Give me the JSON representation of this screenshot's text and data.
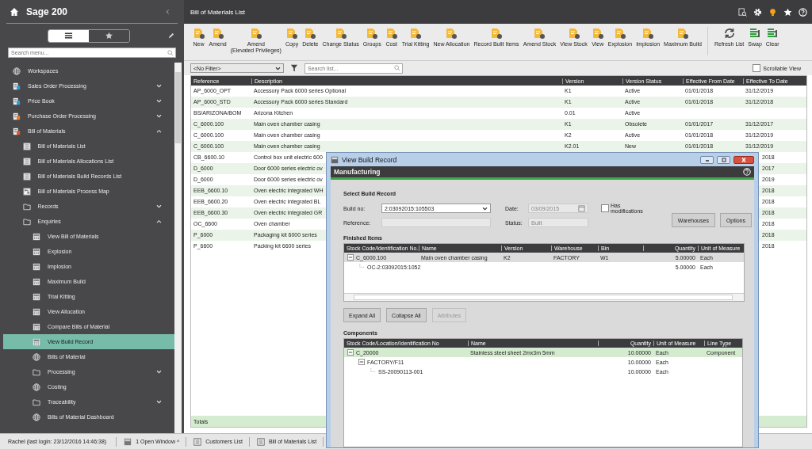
{
  "sidebar": {
    "title": "Sage 200",
    "view_tabs": [
      {
        "kind": "menu",
        "selected": true
      },
      {
        "kind": "favourites",
        "selected": false
      }
    ],
    "search": {
      "placeholder": "Search menu..."
    },
    "items": [
      {
        "label": "Workspaces",
        "kind": "workspace",
        "selected": false
      },
      {
        "label": "Sales Order Processing",
        "kind": "module",
        "selected": false,
        "expanded": false
      },
      {
        "label": "Price Book",
        "kind": "module",
        "selected": false,
        "expanded": false
      },
      {
        "label": "Purchase Order Processing",
        "kind": "module",
        "selected": false,
        "expanded": false
      },
      {
        "label": "Bill of Materials",
        "kind": "module",
        "selected": false,
        "expanded": true,
        "children": [
          {
            "label": "Bill of Materials List",
            "kind": "page",
            "selected": false
          },
          {
            "label": "Bill of Materials Allocations List",
            "kind": "page",
            "selected": false
          },
          {
            "label": "Bill of Materials Build Records List",
            "kind": "page",
            "selected": false
          },
          {
            "label": "Bill of Materials Process Map",
            "kind": "map",
            "selected": false
          },
          {
            "label": "Records",
            "kind": "folder",
            "selected": false,
            "expanded": false
          },
          {
            "label": "Enquiries",
            "kind": "folder",
            "selected": false,
            "expanded": true,
            "children": [
              {
                "label": "View Bill of Materials",
                "kind": "enquiry",
                "selected": false
              },
              {
                "label": "Explosion",
                "kind": "enquiry",
                "selected": false
              },
              {
                "label": "Implosion",
                "kind": "enquiry",
                "selected": false
              },
              {
                "label": "Maximum Build",
                "kind": "enquiry",
                "selected": false
              },
              {
                "label": "Trial Kitting",
                "kind": "enquiry",
                "selected": false
              },
              {
                "label": "View Allocation",
                "kind": "enquiry",
                "selected": false
              },
              {
                "label": "Compare Bills of Material",
                "kind": "enquiry",
                "selected": false
              },
              {
                "label": "View Build Record",
                "kind": "enquiry",
                "selected": true
              },
              {
                "label": "Bills of Material",
                "kind": "workspace",
                "selected": false
              },
              {
                "label": "Processing",
                "kind": "folder",
                "selected": false,
                "expanded": false
              },
              {
                "label": "Costing",
                "kind": "workspace",
                "selected": false
              },
              {
                "label": "Traceability",
                "kind": "folder",
                "selected": false,
                "expanded": false
              },
              {
                "label": "Bills of Material Dashboard",
                "kind": "workspace",
                "selected": false
              }
            ]
          }
        ]
      }
    ]
  },
  "main": {
    "title": "Bill of Materials List",
    "toolbar": {
      "groups": [
        [
          "New",
          "Amend",
          "Amend\n(Elevated Privileges)",
          "Copy",
          "Delete",
          "Change Status",
          "Groups",
          "Cost",
          "Trial Kitting",
          "New Allocation",
          "Record Built Items",
          "Amend Stock",
          "View Stock",
          "View",
          "Explosion",
          "Implosion",
          "Maximum Build"
        ],
        [
          "Refresh List",
          "Swap",
          "Clear"
        ]
      ]
    },
    "filter": {
      "value": "<No Filter>"
    },
    "search": {
      "placeholder": "Search list..."
    },
    "scrollable_view": {
      "label": "Scrollable View",
      "checked": false
    },
    "table": {
      "columns": [
        "Reference",
        "Description",
        "Version",
        "Version Status",
        "Effective From Date",
        "Effective To Date"
      ],
      "rows": [
        {
          "reference": "AP_6000_OPT",
          "description": "Accessory Pack 6000 series Optional",
          "version": "K1",
          "version_status": "Active",
          "effective_from": "01/01/2018",
          "effective_to": "31/12/2019"
        },
        {
          "reference": "AP_6000_STD",
          "description": "Accessory Pack 6000 series Standard",
          "version": "K1",
          "version_status": "Active",
          "effective_from": "01/01/2018",
          "effective_to": "31/12/2018"
        },
        {
          "reference": "BS/ARIZONA/BOM",
          "description": "Arizona Kitchen",
          "version": "0.01",
          "version_status": "Active"
        },
        {
          "reference": "C_6000.100",
          "description": "Main oven chamber casing",
          "version": "K1",
          "version_status": "Obsolete",
          "effective_from": "01/01/2017",
          "effective_to": "31/12/2017"
        },
        {
          "reference": "C_6000.100",
          "description": "Main oven chamber casing",
          "version": "K2",
          "version_status": "Active",
          "effective_from": "01/01/2018",
          "effective_to": "31/12/2019"
        },
        {
          "reference": "C_6000.100",
          "description": "Main oven chamber casing",
          "version": "K2.01",
          "version_status": "New",
          "effective_from": "01/01/2018",
          "effective_to": "31/12/2019"
        },
        {
          "reference": "CB_6600.10",
          "description": "Control box unit electric 600",
          "effective_to": "2018"
        },
        {
          "reference": "D_6000",
          "description": "Door 6000 series electric ov",
          "effective_to": "2017"
        },
        {
          "reference": "D_6000",
          "description": "Door 6000 series electric ov",
          "effective_to": "2019"
        },
        {
          "reference": "EEB_6600.10",
          "description": "Oven electric integrated WH",
          "effective_to": "2018"
        },
        {
          "reference": "EEB_6600.20",
          "description": "Oven electric integrated BL",
          "effective_to": "2018"
        },
        {
          "reference": "EEB_6600.30",
          "description": "Oven electric integrated GR",
          "effective_to": "2018"
        },
        {
          "reference": "OC_6600",
          "description": "Oven chamber",
          "effective_to": "2018"
        },
        {
          "reference": "P_6000",
          "description": "Packaging kit 6000 series",
          "effective_to": "2018"
        },
        {
          "reference": "P_6600",
          "description": "Packing kit 6600 series",
          "effective_to": "2018"
        }
      ],
      "totals_label": "Totals"
    }
  },
  "dialog": {
    "title": "View Build Record",
    "header": "Manufacturing",
    "section_title": "Select Build Record",
    "build_no": {
      "label": "Build no:",
      "value": "2:03092015:105503"
    },
    "date": {
      "label": "Date:",
      "value": "03/09/2015"
    },
    "has_modifications": {
      "label": "Has modifications",
      "checked": false
    },
    "reference": {
      "label": "Reference:"
    },
    "status": {
      "label": "Status:",
      "value": "Built"
    },
    "buttons": [
      "Warehouses",
      "Options"
    ],
    "finished_items": {
      "title": "Finished Items",
      "focused": false,
      "columns": [
        "Stock Code/Identification No.",
        "Name",
        "Version",
        "Warehouse",
        "Bin",
        "Quantity",
        "Unit of Measure"
      ],
      "rows": [
        {
          "stock_code": "C_6000.100",
          "name": "Main oven chamber casing",
          "version": "K2",
          "warehouse": "FACTORY",
          "bin": "W1",
          "quantity": "5.00000",
          "unit": "Each",
          "selected": true,
          "expanded": true,
          "children": [
            {
              "stock_code": "OC-2:03092015:1052",
              "quantity": "5.00000",
              "unit": "Each",
              "selected": false
            }
          ]
        }
      ]
    },
    "tree_buttons": [
      {
        "label": "Expand All",
        "disabled": false
      },
      {
        "label": "Collapse All",
        "disabled": false
      },
      {
        "label": "Attributes",
        "disabled": true
      }
    ],
    "components": {
      "title": "Components",
      "focused": true,
      "columns": [
        "Stock Code/Location/Identification No",
        "Name",
        "Quantity",
        "Unit of Measure",
        "Line Type"
      ],
      "rows": [
        {
          "stock_code": "C_20000",
          "name": "Stainless steel sheet 2mx3m 5mm",
          "quantity": "10.00000",
          "unit": "Each",
          "line_type": "Component",
          "selected": true,
          "expanded": true,
          "children": [
            {
              "stock_code": "FACTORY/F11",
              "quantity": "10.00000",
              "unit": "Each",
              "selected": false,
              "expanded": true,
              "children": [
                {
                  "stock_code": "SS-20090113-001",
                  "quantity": "10.00000",
                  "unit": "Each",
                  "selected": false
                }
              ]
            }
          ]
        }
      ]
    }
  },
  "status_bar": {
    "user": "Rachel (last login: 23/12/2016 14:46:38)",
    "open_windows": "1 Open Window ^",
    "tabs": [
      "Customers List",
      "Bill of Materials List"
    ]
  }
}
